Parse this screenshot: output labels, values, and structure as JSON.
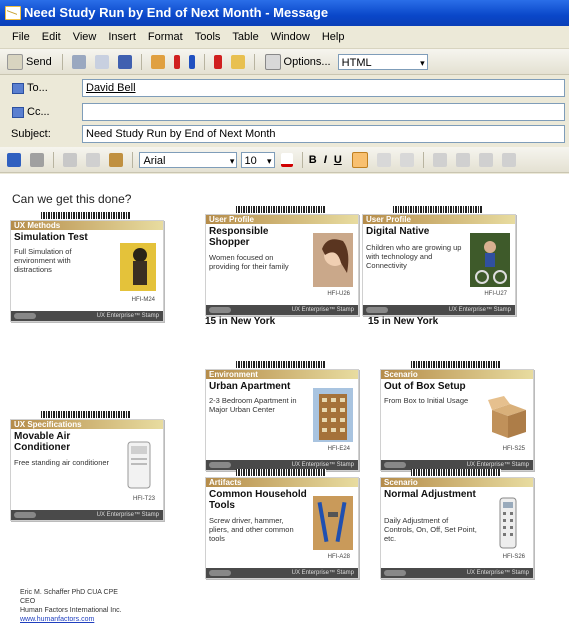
{
  "window": {
    "title": "Need Study Run by End of Next Month - Message"
  },
  "menu": [
    "File",
    "Edit",
    "View",
    "Insert",
    "Format",
    "Tools",
    "Table",
    "Window",
    "Help"
  ],
  "toolbar": {
    "send_label": "Send",
    "options_label": "Options...",
    "format_value": "HTML"
  },
  "header": {
    "to_label": "To...",
    "to_value": "David Bell",
    "cc_label": "Cc...",
    "cc_value": "",
    "subject_label": "Subject:",
    "subject_value": "Need Study Run by End of Next Month"
  },
  "formatting": {
    "font": "Arial",
    "size": "10",
    "bold": "B",
    "italic": "I",
    "underline": "U"
  },
  "body": {
    "intro": "Can we get this done?",
    "cards": [
      {
        "category": "UX Methods",
        "title": "Simulation Test",
        "description": "Full Simulation of environment with distractions",
        "code": "HFI-M24",
        "footer": "UX Enterprise™ Stamp",
        "icon": "tester-figure-icon"
      },
      {
        "category": "User Profile",
        "title": "Responsible Shopper",
        "description": "Women focused on providing for their family",
        "code": "HFI-U26",
        "footer": "UX Enterprise™ Stamp",
        "icon": "woman-portrait-icon"
      },
      {
        "category": "User Profile",
        "title": "Digital Native",
        "description": "Children who are growing up with technology and Connectivity",
        "code": "HFI-U27",
        "footer": "UX Enterprise™ Stamp",
        "icon": "child-on-bike-icon"
      },
      {
        "category": "Environment",
        "title": "Urban Apartment",
        "description": "2-3 Bedroom Apartment in Major Urban Center",
        "code": "HFI-E24",
        "footer": "UX Enterprise™ Stamp",
        "icon": "apartment-building-icon"
      },
      {
        "category": "Scenario",
        "title": "Out of Box Setup",
        "description": "From Box to Initial Usage",
        "code": "HFI-S25",
        "footer": "UX Enterprise™ Stamp",
        "icon": "cardboard-box-icon"
      },
      {
        "category": "UX Specifications",
        "title": "Movable Air Conditioner",
        "description": "Free standing air conditioner",
        "code": "HFI-T23",
        "footer": "UX Enterprise™ Stamp",
        "icon": "air-conditioner-icon"
      },
      {
        "category": "Artifacts",
        "title": "Common Household Tools",
        "description": "Screw driver, hammer, pliers, and other common tools",
        "code": "HFI-A28",
        "footer": "UX Enterprise™ Stamp",
        "icon": "tools-icon"
      },
      {
        "category": "Scenario",
        "title": "Normal Adjustment",
        "description": "Daily Adjustment of Controls, On, Off, Set Point, etc.",
        "code": "HFI-S26",
        "footer": "UX Enterprise™ Stamp",
        "icon": "remote-control-icon"
      }
    ],
    "captions": [
      "15 in New York",
      "15 in New York"
    ],
    "signature": {
      "name": "Eric M. Schaffer PhD CUA CPE",
      "role": "CEO",
      "company": "Human Factors International Inc.",
      "website": "www.humanfactors.com"
    }
  },
  "colors": {
    "title_bar": "#0a47c9",
    "chrome": "#ece9d8",
    "card_footer": "#4a4a4a",
    "link": "#1f3fbf"
  }
}
